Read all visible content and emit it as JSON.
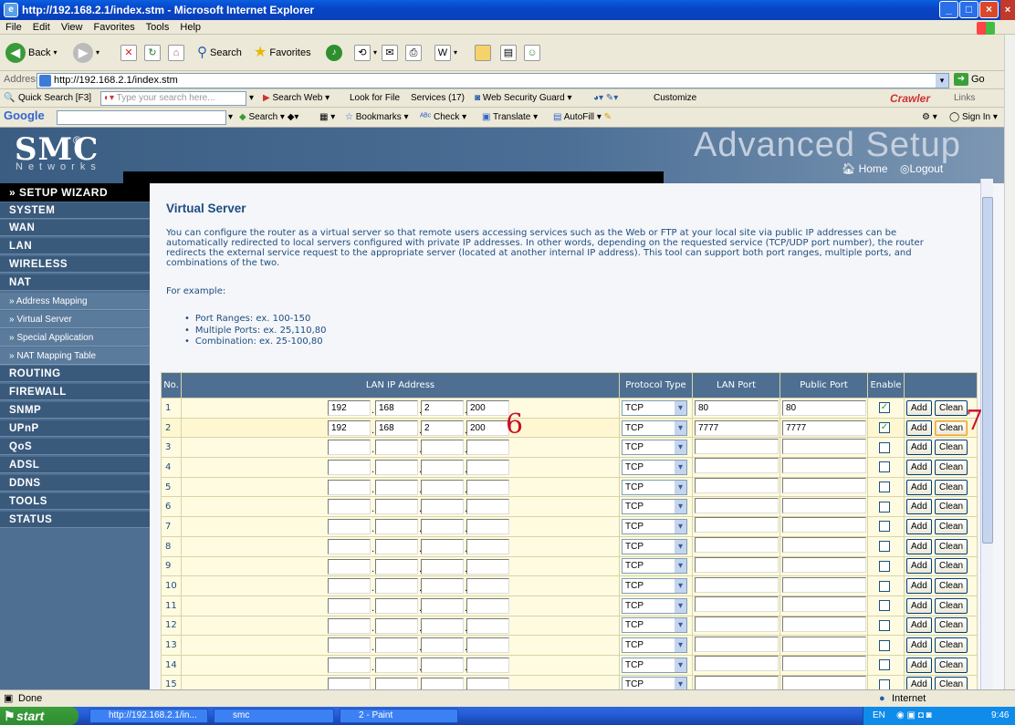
{
  "window": {
    "title": "http://192.168.2.1/index.stm - Microsoft Internet Explorer"
  },
  "menu": [
    "File",
    "Edit",
    "View",
    "Favorites",
    "Tools",
    "Help"
  ],
  "toolbar": {
    "back": "Back",
    "search": "Search",
    "favorites": "Favorites"
  },
  "address": {
    "label": "Address",
    "url": "http://192.168.2.1/index.stm",
    "go": "Go"
  },
  "quicksearch": {
    "label": "Quick Search [F3]",
    "placeholder": "Type your search here...",
    "search_web": "Search Web",
    "look_for_file": "Look for File",
    "services": "Services (17)",
    "web_security_guard": "Web Security Guard",
    "customize": "Customize",
    "crawler": "Crawler",
    "links": "Links"
  },
  "googlebar": {
    "logo": "Google",
    "search": "Search",
    "bookmarks": "Bookmarks",
    "check": "Check",
    "translate": "Translate",
    "autofill": "AutoFill",
    "signin": "Sign In"
  },
  "router": {
    "logo": "SMC",
    "logo_reg": "®",
    "logo_sub": "Networks",
    "header_title": "Advanced Setup",
    "home": "Home",
    "logout": "Logout"
  },
  "sidebar": {
    "wizard": "» SETUP WIZARD",
    "top": [
      "SYSTEM",
      "WAN",
      "LAN",
      "WIRELESS",
      "NAT"
    ],
    "nat_sub": [
      "» Address Mapping",
      "» Virtual Server",
      "» Special Application",
      "» NAT Mapping Table"
    ],
    "bottom": [
      "ROUTING",
      "FIREWALL",
      "SNMP",
      "UPnP",
      "QoS",
      "ADSL",
      "DDNS",
      "TOOLS",
      "STATUS"
    ]
  },
  "page": {
    "title": "Virtual Server",
    "description": "You can configure the router as a virtual server so that remote users accessing services such as the Web or FTP at your local site via public IP addresses can be automatically redirected to local servers configured with private IP addresses. In other words, depending on the requested service (TCP/UDP port number), the router redirects the external service request to the appropriate server (located at another internal IP address). This tool can support both port ranges, multiple ports, and combinations of the two.",
    "for_example": "For example:",
    "examples": [
      "Port Ranges: ex. 100-150",
      "Multiple Ports: ex. 25,110,80",
      "Combination: ex. 25-100,80"
    ]
  },
  "table": {
    "headers": {
      "no": "No.",
      "lan_ip": "LAN IP Address",
      "protocol": "Protocol Type",
      "lan_port": "LAN Port",
      "public_port": "Public Port",
      "enable": "Enable"
    },
    "add_label": "Add",
    "clean_label": "Clean",
    "rows": [
      {
        "no": "1",
        "ip": [
          "192",
          "168",
          "2",
          "200"
        ],
        "protocol": "TCP",
        "lan_port": "80",
        "public_port": "80",
        "enabled": true
      },
      {
        "no": "2",
        "ip": [
          "192",
          "168",
          "2",
          "200"
        ],
        "protocol": "TCP",
        "lan_port": "7777",
        "public_port": "7777",
        "enabled": true
      },
      {
        "no": "3",
        "ip": [
          "",
          "",
          "",
          ""
        ],
        "protocol": "TCP",
        "lan_port": "",
        "public_port": "",
        "enabled": false
      },
      {
        "no": "4",
        "ip": [
          "",
          "",
          "",
          ""
        ],
        "protocol": "TCP",
        "lan_port": "",
        "public_port": "",
        "enabled": false
      },
      {
        "no": "5",
        "ip": [
          "",
          "",
          "",
          ""
        ],
        "protocol": "TCP",
        "lan_port": "",
        "public_port": "",
        "enabled": false
      },
      {
        "no": "6",
        "ip": [
          "",
          "",
          "",
          ""
        ],
        "protocol": "TCP",
        "lan_port": "",
        "public_port": "",
        "enabled": false
      },
      {
        "no": "7",
        "ip": [
          "",
          "",
          "",
          ""
        ],
        "protocol": "TCP",
        "lan_port": "",
        "public_port": "",
        "enabled": false
      },
      {
        "no": "8",
        "ip": [
          "",
          "",
          "",
          ""
        ],
        "protocol": "TCP",
        "lan_port": "",
        "public_port": "",
        "enabled": false
      },
      {
        "no": "9",
        "ip": [
          "",
          "",
          "",
          ""
        ],
        "protocol": "TCP",
        "lan_port": "",
        "public_port": "",
        "enabled": false
      },
      {
        "no": "10",
        "ip": [
          "",
          "",
          "",
          ""
        ],
        "protocol": "TCP",
        "lan_port": "",
        "public_port": "",
        "enabled": false
      },
      {
        "no": "11",
        "ip": [
          "",
          "",
          "",
          ""
        ],
        "protocol": "TCP",
        "lan_port": "",
        "public_port": "",
        "enabled": false
      },
      {
        "no": "12",
        "ip": [
          "",
          "",
          "",
          ""
        ],
        "protocol": "TCP",
        "lan_port": "",
        "public_port": "",
        "enabled": false
      },
      {
        "no": "13",
        "ip": [
          "",
          "",
          "",
          ""
        ],
        "protocol": "TCP",
        "lan_port": "",
        "public_port": "",
        "enabled": false
      },
      {
        "no": "14",
        "ip": [
          "",
          "",
          "",
          ""
        ],
        "protocol": "TCP",
        "lan_port": "",
        "public_port": "",
        "enabled": false
      },
      {
        "no": "15",
        "ip": [
          "",
          "",
          "",
          ""
        ],
        "protocol": "TCP",
        "lan_port": "",
        "public_port": "",
        "enabled": false
      }
    ]
  },
  "annotations": [
    "6",
    "7"
  ],
  "status": {
    "left": "Done",
    "zone": "Internet"
  },
  "taskbar": {
    "start": "start",
    "tasks": [
      "http://192.168.2.1/in...",
      "smc",
      "2 - Paint"
    ],
    "lang": "EN",
    "clock": "9:46"
  },
  "colors": {
    "titlebar": "#0a3fb8",
    "sidebar": "#4e6f92",
    "header_text": "#1e4d7e",
    "table_row": "#fffbe0",
    "annotation": "#c8102e"
  }
}
